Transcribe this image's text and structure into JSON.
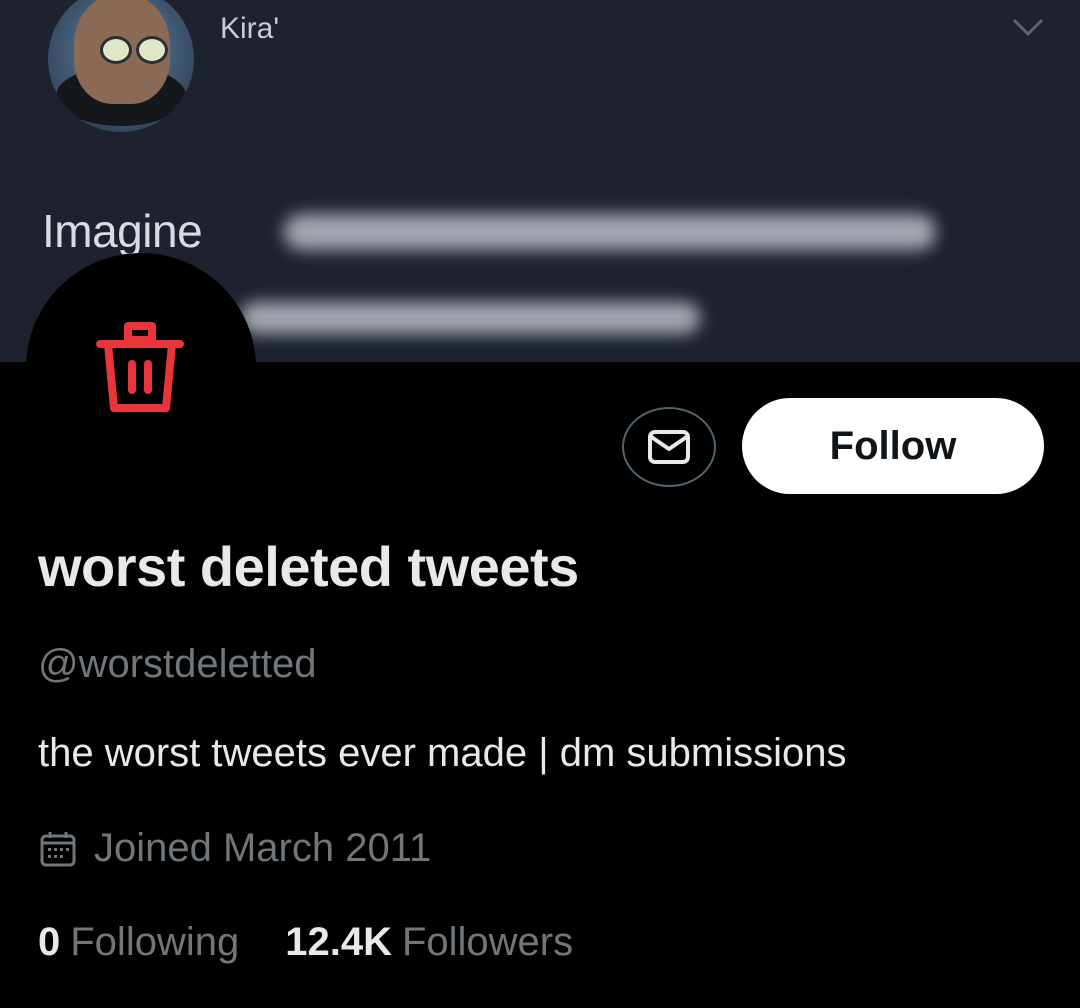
{
  "banner": {
    "embedded_tweet_name": "Kira'",
    "embedded_tweet_text": "Imagine",
    "chevron_icon": "chevron-down-icon"
  },
  "profile": {
    "avatar_icon": "trash-icon",
    "display_name": "worst deleted tweets",
    "handle": "@worstdeletted",
    "bio": "the worst tweets ever made | dm submissions",
    "joined": "Joined March 2011",
    "following_count": "0",
    "following_label": "Following",
    "followers_count": "12.4K",
    "followers_label": "Followers"
  },
  "actions": {
    "message_icon": "envelope-icon",
    "follow_label": "Follow"
  },
  "colors": {
    "background": "#000000",
    "primary_text": "#e7e9ea",
    "secondary_text": "#71767b",
    "trash_red": "#e8343b",
    "follow_bg": "#ffffff"
  }
}
